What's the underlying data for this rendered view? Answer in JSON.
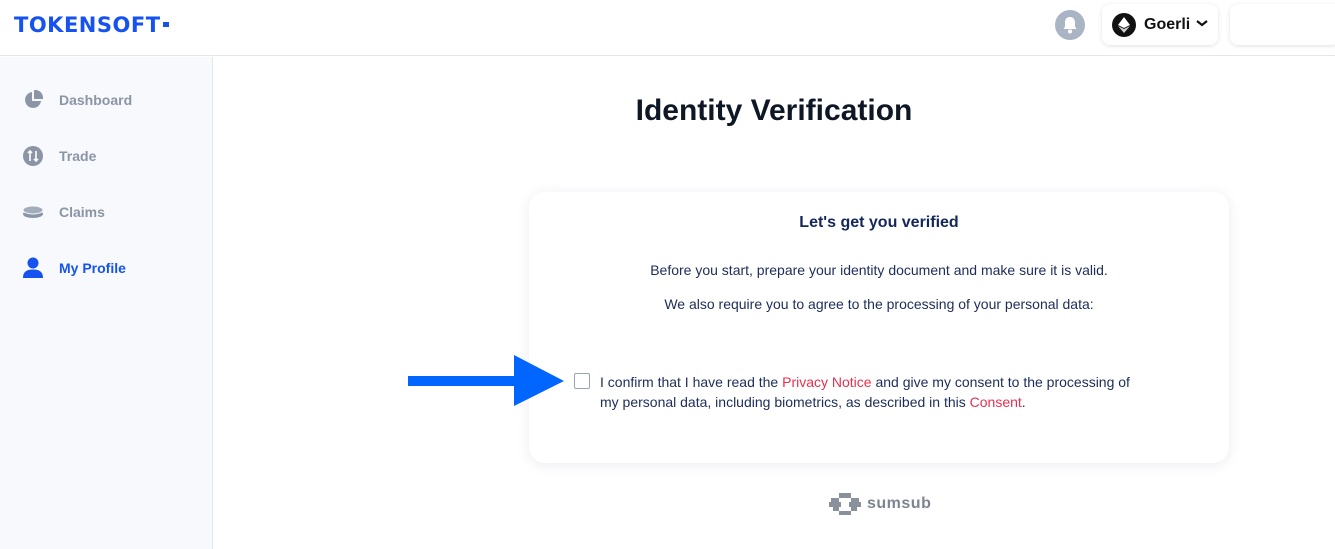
{
  "header": {
    "logo_text": "TOKENSOFT",
    "network_label": "Goerli"
  },
  "sidebar": {
    "items": [
      {
        "label": "Dashboard",
        "icon": "pie-chart-icon",
        "active": false
      },
      {
        "label": "Trade",
        "icon": "trade-icon",
        "active": false
      },
      {
        "label": "Claims",
        "icon": "coins-icon",
        "active": false
      },
      {
        "label": "My Profile",
        "icon": "user-icon",
        "active": true
      }
    ]
  },
  "main": {
    "title": "Identity Verification",
    "card": {
      "heading": "Let's get you verified",
      "paragraph1": "Before you start, prepare your identity document and make sure it is valid.",
      "paragraph2": "We also require you to agree to the processing of your personal data:",
      "consent": {
        "checked": false,
        "text_part1": "I confirm that I have read the ",
        "privacy_link": "Privacy Notice",
        "text_part2": " and give my consent to the processing of my personal data, including biometrics, as described in this ",
        "consent_link": "Consent",
        "text_part3": "."
      }
    },
    "footer_brand": "sumsub"
  },
  "colors": {
    "brand_blue": "#1652f0",
    "link_red": "#e8304d",
    "arrow_blue": "#0066ff"
  }
}
